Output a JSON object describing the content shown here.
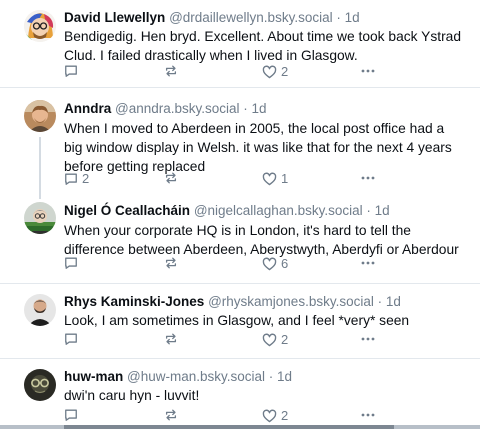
{
  "colors": {
    "text": "#0b0f14",
    "muted": "#6f7c8a",
    "divider": "#e3e8ed"
  },
  "icons": {
    "reply": "speech-bubble-icon",
    "repost": "repost-arrows-icon",
    "like": "heart-icon",
    "more": "ellipsis-icon"
  },
  "posts": [
    {
      "name": "David Llewellyn",
      "handle": "@drdaillewellyn.bsky.social",
      "time": "· 1d",
      "text": "Bendigedig. Hen bryd. Excellent. About time we took back Ystrad Clud. I failed drastically when I lived in Glasgow.",
      "replies": "",
      "reposts": "",
      "likes": "2"
    },
    {
      "name": "Anndra",
      "handle": "@anndra.bsky.social",
      "time": "· 1d",
      "text": "When I moved to Aberdeen in 2005, the local post office had a big window display in Welsh. it was like that for the next 4 years before getting replaced",
      "replies": "2",
      "reposts": "",
      "likes": "1"
    },
    {
      "name": "Nigel Ó Ceallacháin",
      "handle": "@nigelcallaghan.bsky.social",
      "time": "· 1d",
      "text": "When your corporate HQ is in London, it's hard to tell the difference between Aberdeen, Aberystwyth, Aberdyfi or Aberdour",
      "replies": "",
      "reposts": "",
      "likes": "6"
    },
    {
      "name": "Rhys Kaminski-Jones",
      "handle": "@rhyskamjones.bsky.social",
      "time": "· 1d",
      "text": "Look, I am sometimes in Glasgow, and I feel *very* seen",
      "replies": "",
      "reposts": "",
      "likes": "2"
    },
    {
      "name": "huw-man",
      "handle": "@huw-man.bsky.social",
      "time": "· 1d",
      "text": "dwi'n caru hyn - luvvit!",
      "replies": "",
      "reposts": "",
      "likes": "2"
    }
  ]
}
